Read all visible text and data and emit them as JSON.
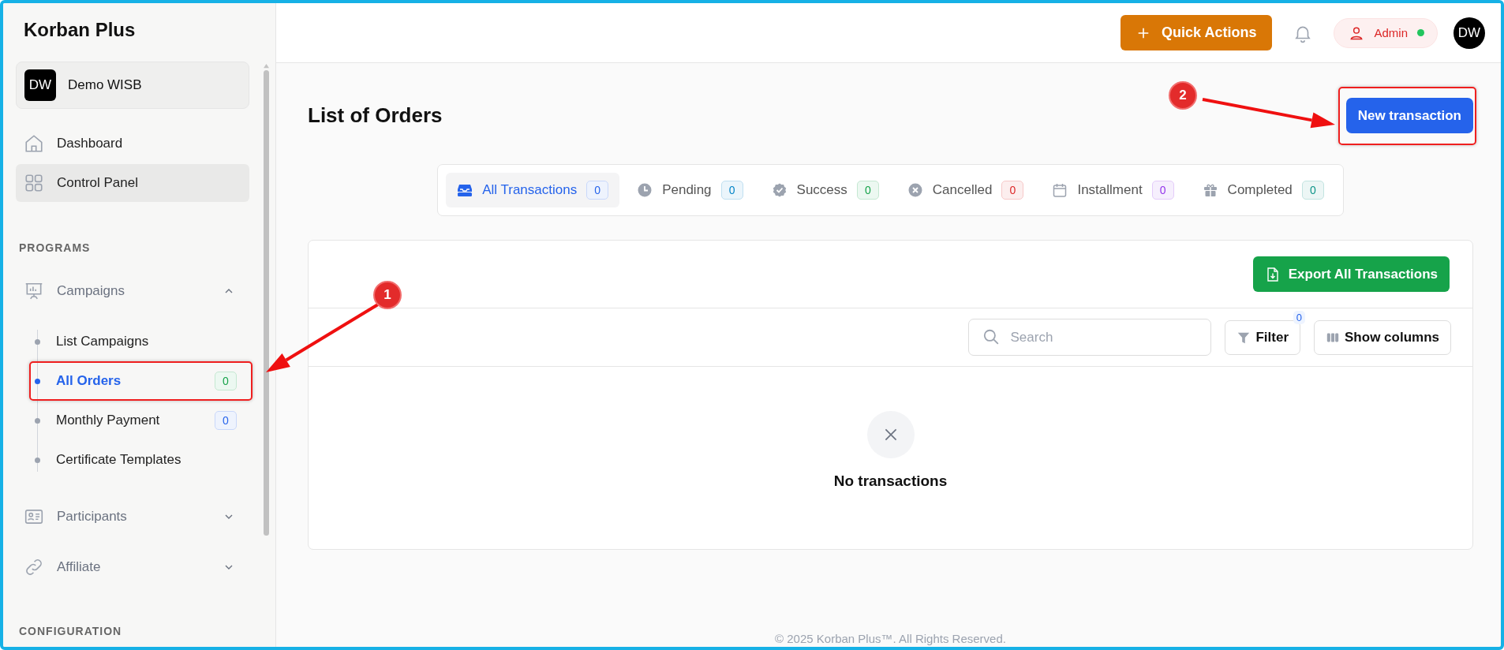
{
  "brand": "Korban Plus",
  "workspace": {
    "initials": "DW",
    "name": "Demo WISB"
  },
  "nav": [
    {
      "label": "Dashboard",
      "selected": false
    },
    {
      "label": "Control Panel",
      "selected": true
    }
  ],
  "sections": [
    {
      "title": "PROGRAMS",
      "groups": [
        {
          "label": "Campaigns",
          "expanded": true,
          "children": [
            {
              "label": "List Campaigns",
              "selected": false
            },
            {
              "label": "All Orders",
              "selected": true,
              "count": "0",
              "color": "#16a34a"
            },
            {
              "label": "Monthly Payment",
              "selected": false,
              "count": "0",
              "color": "#2563eb"
            },
            {
              "label": "Certificate Templates",
              "selected": false
            }
          ]
        },
        {
          "label": "Participants",
          "expanded": false
        },
        {
          "label": "Affiliate",
          "expanded": false
        }
      ]
    },
    {
      "title": "CONFIGURATION"
    }
  ],
  "topbar": {
    "quick_actions": "Quick Actions",
    "user": {
      "name": "Admin",
      "online": true
    },
    "avatar": "DW"
  },
  "page_title": "List of Orders",
  "new_button": "New transaction",
  "tabs": [
    {
      "label": "All Transactions",
      "count": "0",
      "color": "#2563eb",
      "selected": true
    },
    {
      "label": "Pending",
      "count": "0",
      "color": "#0284c7",
      "selected": false
    },
    {
      "label": "Success",
      "count": "0",
      "color": "#16a34a",
      "selected": false
    },
    {
      "label": "Cancelled",
      "count": "0",
      "color": "#dc2626",
      "selected": false
    },
    {
      "label": "Installment",
      "count": "0",
      "color": "#9333ea",
      "selected": false
    },
    {
      "label": "Completed",
      "count": "0",
      "color": "#0d9488",
      "selected": false
    }
  ],
  "export_button": "Export All Transactions",
  "search": {
    "placeholder": "Search"
  },
  "filter": {
    "label": "Filter",
    "count": "0"
  },
  "columns_button": "Show columns",
  "empty_state": "No transactions",
  "footer": "© 2025 Korban Plus™. All Rights Reserved.",
  "annotations": [
    {
      "label": "1"
    },
    {
      "label": "2"
    }
  ]
}
